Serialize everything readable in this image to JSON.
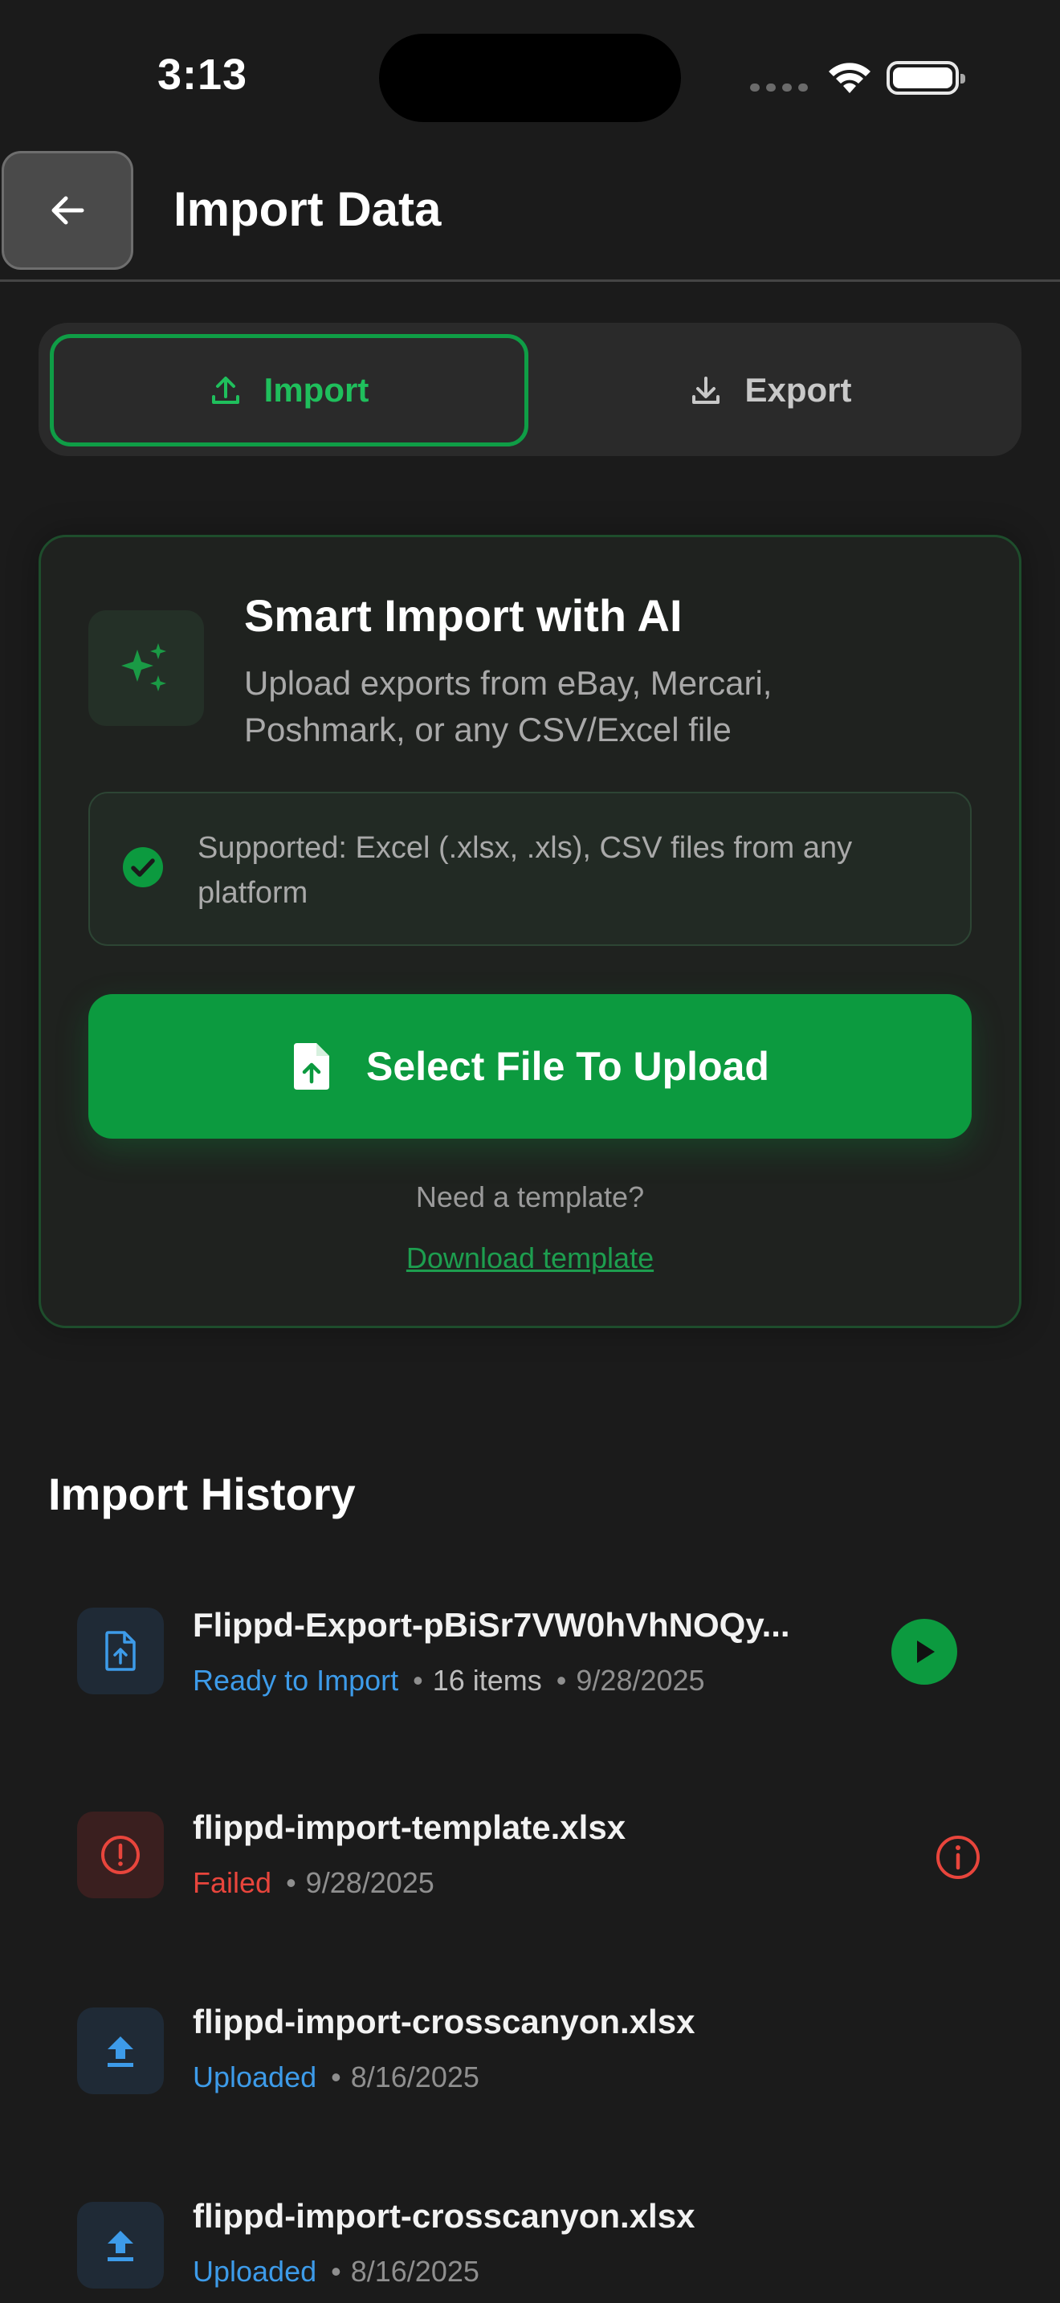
{
  "status_bar": {
    "time": "3:13"
  },
  "header": {
    "title": "Import Data",
    "back_icon": "arrow-left-icon"
  },
  "tabs": [
    {
      "label": "Import",
      "icon": "upload-icon",
      "active": true
    },
    {
      "label": "Export",
      "icon": "download-icon",
      "active": false
    }
  ],
  "import_card": {
    "icon": "sparkles-icon",
    "title": "Smart Import with AI",
    "description": "Upload exports from eBay, Mercari, Poshmark, or any CSV/Excel file",
    "supported_text": "Supported: Excel (.xlsx, .xls), CSV files from any platform",
    "select_button": "Select File To Upload",
    "need_template": "Need a template?",
    "download_link": "Download template"
  },
  "history": {
    "title": "Import History",
    "items": [
      {
        "name": "Flippd-Export-pBiSr7VW0hVhNOQy...",
        "status": "Ready to Import",
        "status_color": "#3d9be9",
        "count": "16 items",
        "date": "9/28/2025",
        "icon": "file-upload-icon",
        "action": "play-icon"
      },
      {
        "name": "flippd-import-template.xlsx",
        "status": "Failed",
        "status_color": "#e8453c",
        "date": "9/28/2025",
        "icon": "alert-circle-icon",
        "action": "info-icon"
      },
      {
        "name": "flippd-import-crosscanyon.xlsx",
        "status": "Uploaded",
        "status_color": "#3d9be9",
        "date": "8/16/2025",
        "icon": "upload-arrow-icon"
      },
      {
        "name": "flippd-import-crosscanyon.xlsx",
        "status": "Uploaded",
        "status_color": "#3d9be9",
        "date": "8/16/2025",
        "icon": "upload-arrow-icon"
      }
    ]
  },
  "colors": {
    "accent": "#0c9a3f",
    "background": "#1b1b1b",
    "link_blue": "#3d9be9",
    "error_red": "#e8453c"
  }
}
